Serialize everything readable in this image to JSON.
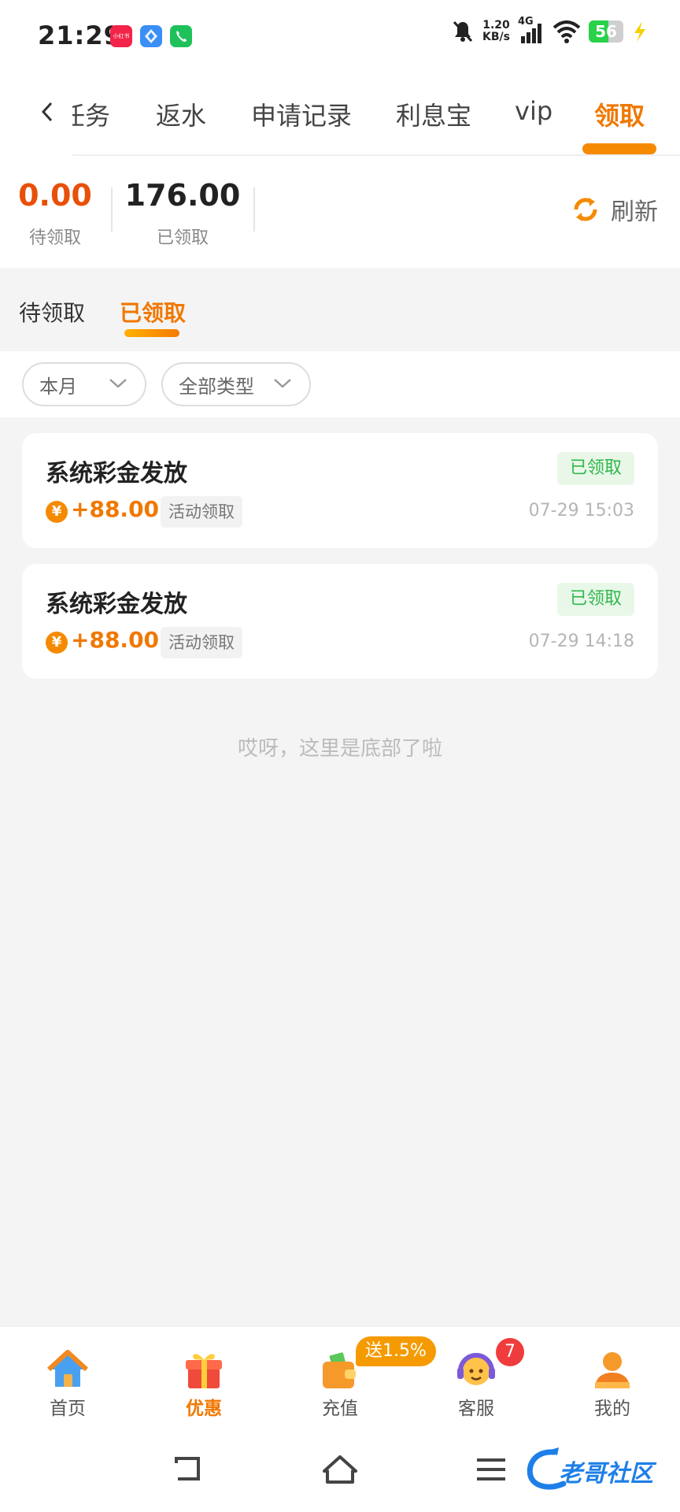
{
  "status_bar": {
    "time": "21:29",
    "speed_value": "1.20",
    "speed_unit": "KB/s",
    "network": "4G",
    "battery": "56",
    "battery_fill": 0.56,
    "apps": [
      "xiaohongshu-icon",
      "dingtalk-icon",
      "phone-icon"
    ],
    "app_text": [
      "小红书"
    ]
  },
  "top_tabs": {
    "items": [
      "任务",
      "返水",
      "申请记录",
      "利息宝",
      "vip",
      "领取"
    ],
    "active_index": 5
  },
  "summary": {
    "pending_value": "0.00",
    "pending_label": "待领取",
    "received_value": "176.00",
    "received_label": "已领取",
    "refresh_label": "刷新"
  },
  "sub_tabs": {
    "items": [
      "待领取",
      "已领取"
    ],
    "active_index": 1
  },
  "filters": {
    "month": "本月",
    "type": "全部类型"
  },
  "records": [
    {
      "title": "系统彩金发放",
      "status": "已领取",
      "coin": "¥",
      "amount": "+88.00",
      "tag": "活动领取",
      "time": "07-29 15:03"
    },
    {
      "title": "系统彩金发放",
      "status": "已领取",
      "coin": "¥",
      "amount": "+88.00",
      "tag": "活动领取",
      "time": "07-29 14:18"
    }
  ],
  "list_end_message": "哎呀，这里是底部了啦",
  "bottom_nav": {
    "items": [
      {
        "label": "首页",
        "icon": "home-icon"
      },
      {
        "label": "优惠",
        "icon": "gift-icon"
      },
      {
        "label": "充值",
        "icon": "wallet-icon"
      },
      {
        "label": "客服",
        "icon": "support-icon"
      },
      {
        "label": "我的",
        "icon": "user-icon"
      }
    ],
    "active_index": 1,
    "promo_badge": "送1.5%",
    "service_count": "7"
  },
  "watermark": "老哥社区",
  "colors": {
    "accent": "#f07800",
    "pending": "#e8500a",
    "success": "#2db84a",
    "badge_red": "#f03c3c"
  }
}
